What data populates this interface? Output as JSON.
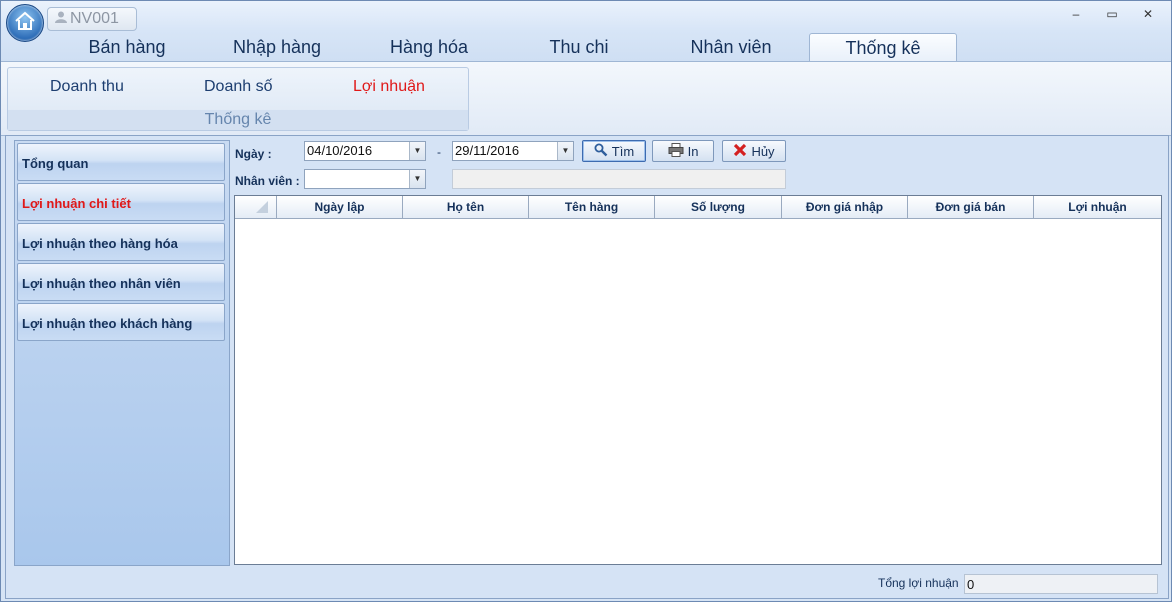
{
  "window": {
    "user": "NV001",
    "controls": {
      "minimize": "–",
      "maximize": "▭",
      "close": "✕"
    }
  },
  "main_tabs": [
    {
      "label": "Bán hàng"
    },
    {
      "label": "Nhập hàng"
    },
    {
      "label": "Hàng hóa"
    },
    {
      "label": "Thu chi"
    },
    {
      "label": "Nhân viên"
    },
    {
      "label": "Thống kê",
      "active": true
    }
  ],
  "ribbon": {
    "group_label": "Thống kê",
    "buttons": [
      {
        "label": "Doanh thu"
      },
      {
        "label": "Doanh số"
      },
      {
        "label": "Lợi nhuận",
        "selected": true
      }
    ]
  },
  "nav": [
    {
      "label": "Tổng quan"
    },
    {
      "label": "Lợi nhuận chi tiết",
      "selected": true
    },
    {
      "label": "Lợi nhuận theo hàng hóa"
    },
    {
      "label": "Lợi nhuận theo nhân viên"
    },
    {
      "label": "Lợi nhuận theo khách hàng"
    }
  ],
  "filters": {
    "date_label": "Ngày :",
    "date_from": "04/10/2016",
    "date_sep": "-",
    "date_to": "29/11/2016",
    "employee_label": "Nhân viên :",
    "employee_value": "",
    "employee_name": ""
  },
  "actions": {
    "search": "Tìm",
    "print": "In",
    "cancel": "Hủy"
  },
  "grid": {
    "columns": [
      "Ngày lập",
      "Họ tên",
      "Tên hàng",
      "Số lượng",
      "Đơn giá nhập",
      "Đơn giá bán",
      "Lợi nhuận"
    ],
    "rows": []
  },
  "footer": {
    "total_label": "Tổng lợi nhuận",
    "total_value": "0"
  },
  "colors": {
    "accent_selected": "#e01818",
    "text": "#15315a",
    "background": "#d6e4f5"
  }
}
